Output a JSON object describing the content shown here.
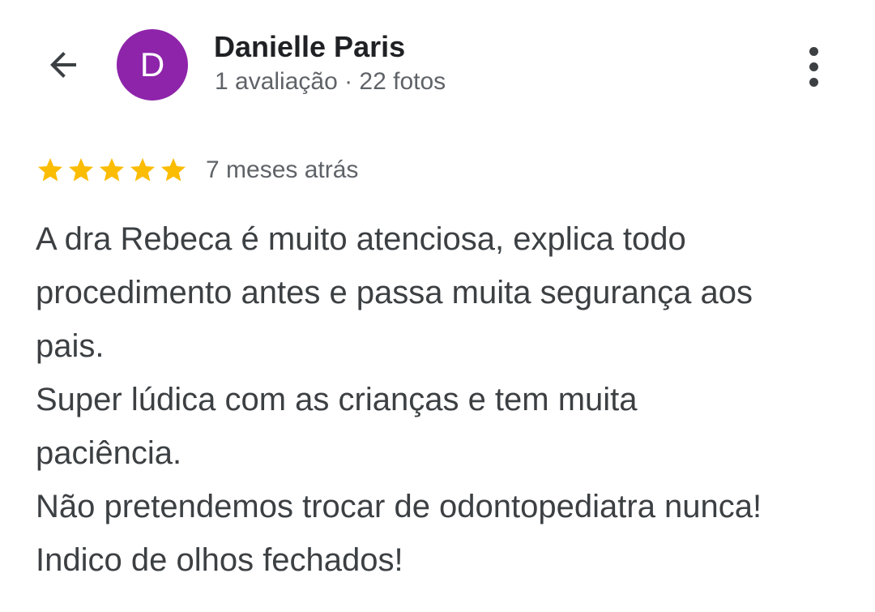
{
  "header": {
    "back_icon": "arrow-back-icon",
    "avatar_initial": "D",
    "avatar_color": "#8e24aa",
    "user_name": "Danielle Paris",
    "user_meta": "1 avaliação · 22 fotos",
    "more_icon": "more-vert-icon"
  },
  "review": {
    "rating": 5,
    "max_rating": 5,
    "star_color": "#fbbc04",
    "time_ago": "7 meses atrás",
    "lines": [
      "A dra Rebeca é muito atenciosa, explica todo",
      "procedimento antes e passa muita segurança aos",
      "pais.",
      "Super lúdica com as crianças e tem muita",
      "paciência.",
      "Não pretendemos trocar de odontopediatra nunca!",
      "Indico de olhos fechados!"
    ]
  }
}
